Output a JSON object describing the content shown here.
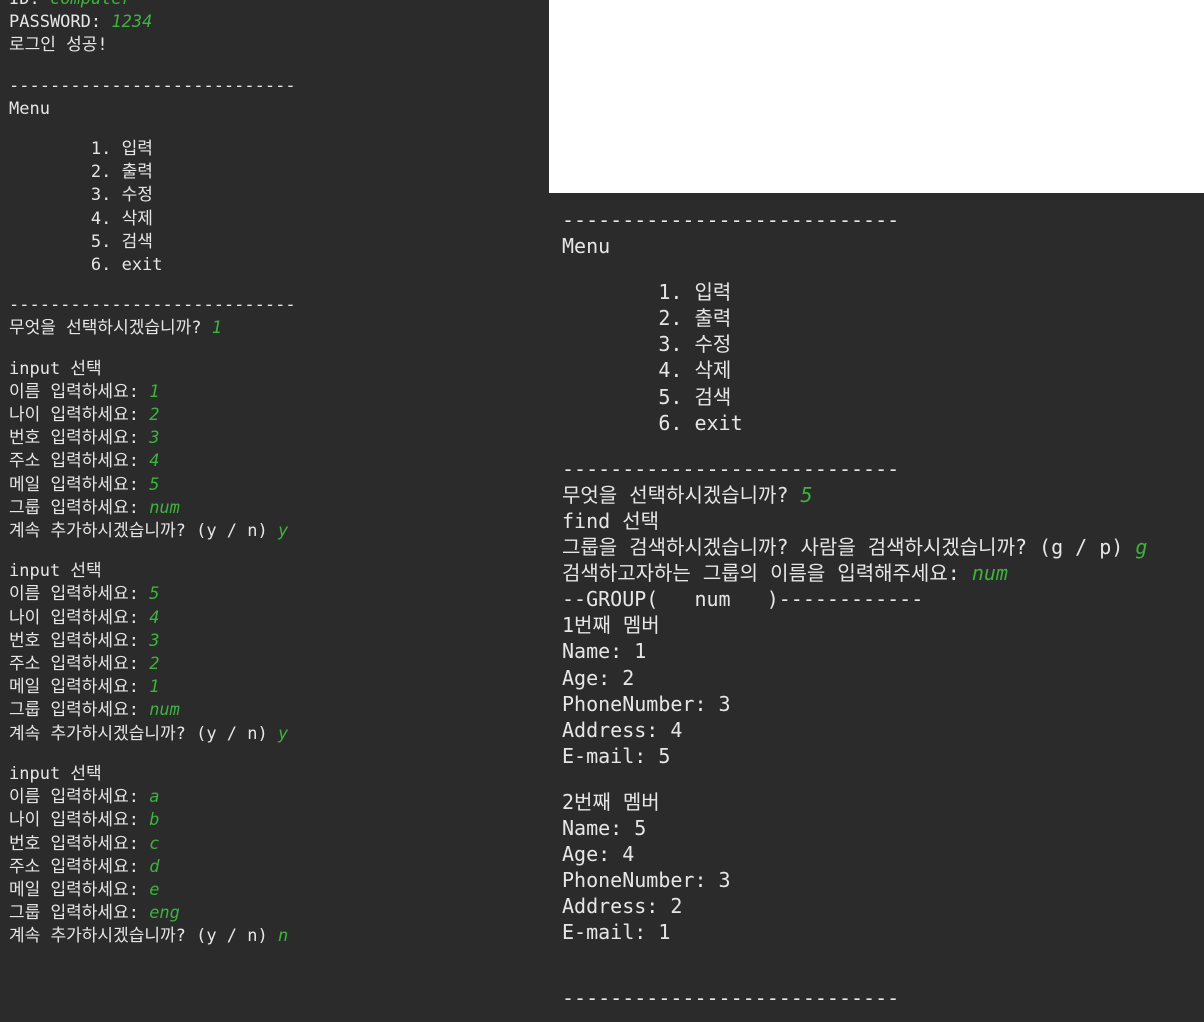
{
  "accent_color": "#3cb43c",
  "left_terminal": {
    "lines": [
      {
        "text": "ID: ",
        "input": "computer"
      },
      {
        "text": "PASSWORD: ",
        "input": "1234"
      },
      {
        "text": "로그인 성공!",
        "input": ""
      },
      {
        "text": "",
        "input": ""
      },
      {
        "text": "----------------------------",
        "input": ""
      },
      {
        "text": "Menu",
        "input": ""
      },
      {
        "text": "",
        "input": ""
      },
      {
        "text": "        1. 입력",
        "input": ""
      },
      {
        "text": "        2. 출력",
        "input": ""
      },
      {
        "text": "        3. 수정",
        "input": ""
      },
      {
        "text": "        4. 삭제",
        "input": ""
      },
      {
        "text": "        5. 검색",
        "input": ""
      },
      {
        "text": "        6. exit",
        "input": ""
      },
      {
        "text": "",
        "input": ""
      },
      {
        "text": "----------------------------",
        "input": ""
      },
      {
        "text": "무엇을 선택하시겠습니까? ",
        "input": "1"
      },
      {
        "text": "",
        "input": ""
      },
      {
        "text": "input 선택",
        "input": ""
      },
      {
        "text": "이름 입력하세요: ",
        "input": "1"
      },
      {
        "text": "나이 입력하세요: ",
        "input": "2"
      },
      {
        "text": "번호 입력하세요: ",
        "input": "3"
      },
      {
        "text": "주소 입력하세요: ",
        "input": "4"
      },
      {
        "text": "메일 입력하세요: ",
        "input": "5"
      },
      {
        "text": "그룹 입력하세요: ",
        "input": "num"
      },
      {
        "text": "계속 추가하시겠습니까? (y / n) ",
        "input": "y"
      },
      {
        "text": "",
        "input": ""
      },
      {
        "text": "input 선택",
        "input": ""
      },
      {
        "text": "이름 입력하세요: ",
        "input": "5"
      },
      {
        "text": "나이 입력하세요: ",
        "input": "4"
      },
      {
        "text": "번호 입력하세요: ",
        "input": "3"
      },
      {
        "text": "주소 입력하세요: ",
        "input": "2"
      },
      {
        "text": "메일 입력하세요: ",
        "input": "1"
      },
      {
        "text": "그룹 입력하세요: ",
        "input": "num"
      },
      {
        "text": "계속 추가하시겠습니까? (y / n) ",
        "input": "y"
      },
      {
        "text": "",
        "input": ""
      },
      {
        "text": "input 선택",
        "input": ""
      },
      {
        "text": "이름 입력하세요: ",
        "input": "a"
      },
      {
        "text": "나이 입력하세요: ",
        "input": "b"
      },
      {
        "text": "번호 입력하세요: ",
        "input": "c"
      },
      {
        "text": "주소 입력하세요: ",
        "input": "d"
      },
      {
        "text": "메일 입력하세요: ",
        "input": "e"
      },
      {
        "text": "그룹 입력하세요: ",
        "input": "eng"
      },
      {
        "text": "계속 추가하시겠습니까? (y / n) ",
        "input": "n"
      }
    ]
  },
  "right_terminal": {
    "lines": [
      {
        "text": "----------------------------",
        "input": ""
      },
      {
        "text": "Menu",
        "input": ""
      },
      {
        "text": "",
        "input": ""
      },
      {
        "text": "        1. 입력",
        "input": ""
      },
      {
        "text": "        2. 출력",
        "input": ""
      },
      {
        "text": "        3. 수정",
        "input": ""
      },
      {
        "text": "        4. 삭제",
        "input": ""
      },
      {
        "text": "        5. 검색",
        "input": ""
      },
      {
        "text": "        6. exit",
        "input": ""
      },
      {
        "text": "",
        "input": ""
      },
      {
        "text": "----------------------------",
        "input": ""
      },
      {
        "text": "무엇을 선택하시겠습니까? ",
        "input": "5"
      },
      {
        "text": "find 선택",
        "input": ""
      },
      {
        "text": "그룹을 검색하시겠습니까? 사람을 검색하시겠습니까? (g / p) ",
        "input": "g"
      },
      {
        "text": "검색하고자하는 그룹의 이름을 입력해주세요: ",
        "input": "num"
      },
      {
        "text": "--GROUP(   num   )------------",
        "input": ""
      },
      {
        "text": "1번째 멤버",
        "input": ""
      },
      {
        "text": "Name: 1",
        "input": ""
      },
      {
        "text": "Age: 2",
        "input": ""
      },
      {
        "text": "PhoneNumber: 3",
        "input": ""
      },
      {
        "text": "Address: 4",
        "input": ""
      },
      {
        "text": "E-mail: 5",
        "input": ""
      },
      {
        "text": "",
        "input": ""
      },
      {
        "text": "2번째 멤버",
        "input": ""
      },
      {
        "text": "Name: 5",
        "input": ""
      },
      {
        "text": "Age: 4",
        "input": ""
      },
      {
        "text": "PhoneNumber: 3",
        "input": ""
      },
      {
        "text": "Address: 2",
        "input": ""
      },
      {
        "text": "E-mail: 1",
        "input": ""
      },
      {
        "text": "",
        "input": ""
      },
      {
        "text": "",
        "input": ""
      },
      {
        "text": "----------------------------",
        "input": ""
      }
    ]
  }
}
